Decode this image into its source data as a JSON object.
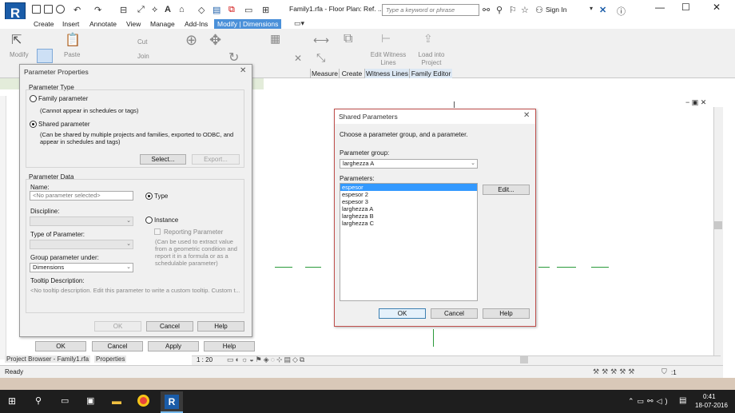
{
  "titlebar": {
    "doc_title": "Family1.rfa - Floor Plan: Ref. ...",
    "search_placeholder": "Type a keyword or phrase",
    "sign_in": "Sign In",
    "app_letter": "R"
  },
  "tabs": [
    "Create",
    "Insert",
    "Annotate",
    "View",
    "Manage",
    "Add-Ins",
    "Modify | Dimensions"
  ],
  "ribbon": {
    "modify": "Modify",
    "paste": "Paste",
    "cut": "Cut",
    "join": "Join",
    "edit_witness": "Edit Witness Lines",
    "load_project": "Load into Project",
    "panels": [
      "Measure",
      "Create",
      "Witness Lines",
      "Family Editor"
    ]
  },
  "param_dialog": {
    "title": "Parameter Properties",
    "parameter_type": "Parameter Type",
    "family_parameter": "Family parameter",
    "family_note": "(Cannot appear in schedules or tags)",
    "shared_parameter": "Shared parameter",
    "shared_note": "(Can be shared by multiple projects and families, exported to ODBC, and appear in schedules and tags)",
    "select": "Select...",
    "export": "Export...",
    "parameter_data": "Parameter Data",
    "name_label": "Name:",
    "name_placeholder": "<No parameter selected>",
    "type_radio": "Type",
    "discipline": "Discipline:",
    "instance_radio": "Instance",
    "type_of_parameter": "Type of Parameter:",
    "reporting": "Reporting Parameter",
    "reporting_note": "(Can be used to extract value from a geometric condition and report it in a formula or as a schedulable parameter)",
    "group_under": "Group parameter under:",
    "group_value": "Dimensions",
    "tooltip_label": "Tooltip Description:",
    "tooltip_value": "<No tooltip description. Edit this parameter to write a custom tooltip. Custom t...",
    "ok": "OK",
    "cancel": "Cancel",
    "help": "Help"
  },
  "outer_buttons": {
    "ok": "OK",
    "cancel": "Cancel",
    "apply": "Apply",
    "help": "Help"
  },
  "shared_dialog": {
    "title": "Shared Parameters",
    "instruction": "Choose a parameter group, and a parameter.",
    "group_label": "Parameter group:",
    "group_value": "larghezza A",
    "params_label": "Parameters:",
    "params": [
      "espesor",
      "espesor 2",
      "espesor 3",
      "larghezza A",
      "larghezza B",
      "larghezza C"
    ],
    "selected_index": 0,
    "edit": "Edit...",
    "ok": "OK",
    "cancel": "Cancel",
    "help": "Help"
  },
  "statusbar": {
    "ready": "Ready",
    "project_browser": "Project Browser - Family1.rfa",
    "properties": "Properties",
    "scale": "1 : 20",
    "filter_count": ":1"
  },
  "taskbar": {
    "time": "0:41",
    "date": "18-07-2016"
  },
  "colors": {
    "accent": "#4a90d9",
    "dialog_border_red": "#c0504d",
    "green_lines": "#2a9a3a",
    "selection": "#3399ff"
  }
}
